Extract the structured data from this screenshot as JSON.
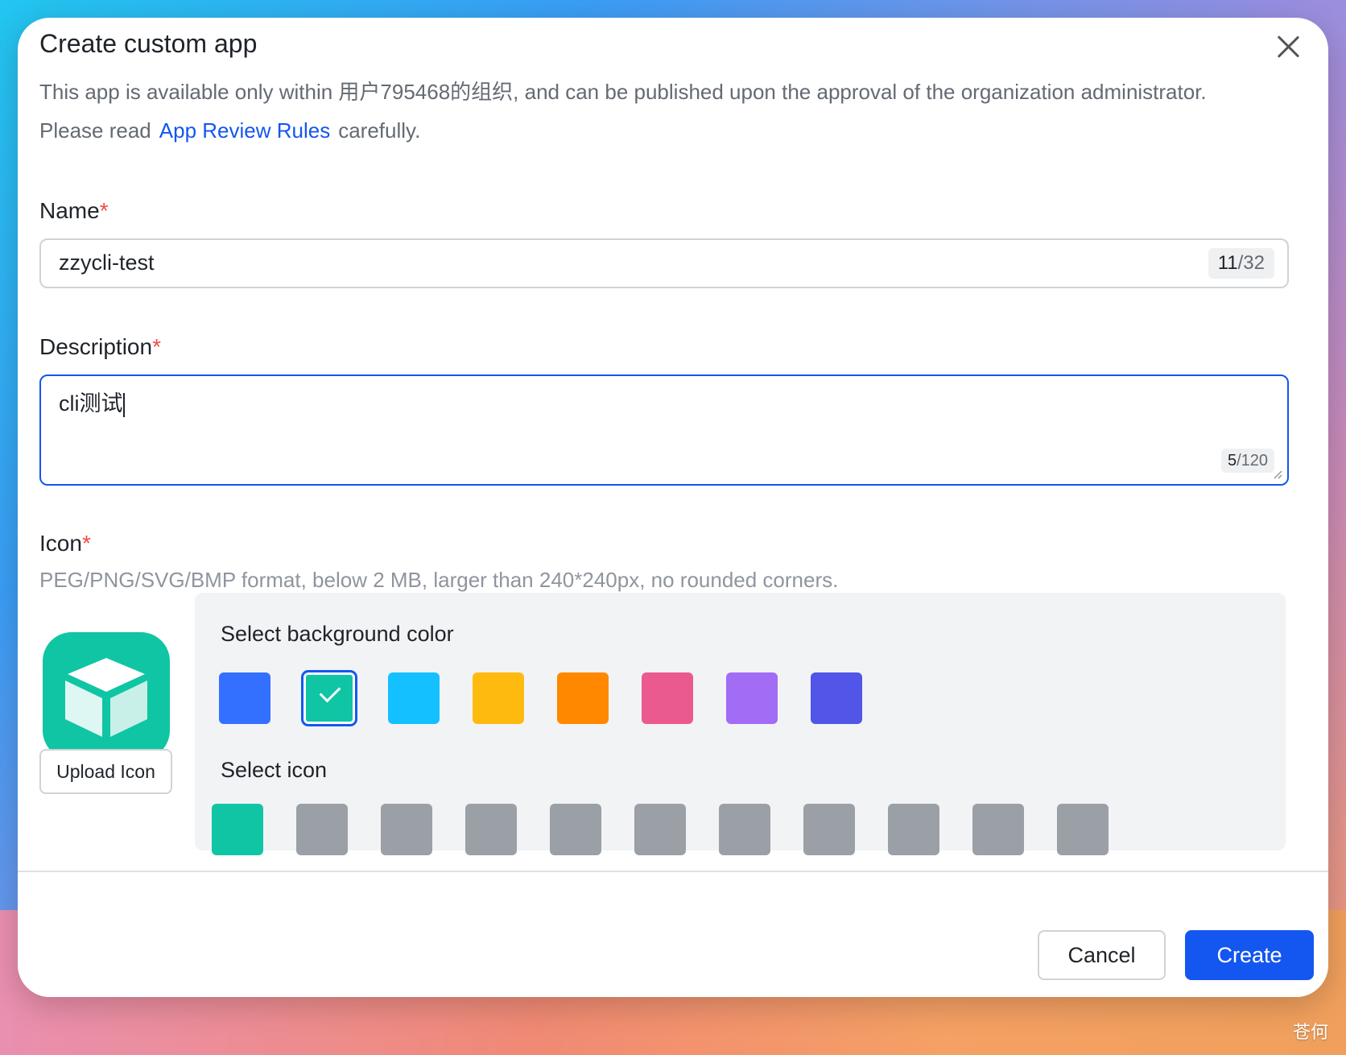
{
  "dialog": {
    "title": "Create custom app",
    "intro_part1": "This app is available only within 用户795468的组织, and can be published upon the approval of the organization administrator. Please read",
    "intro_link": "App Review Rules",
    "intro_part2": "carefully."
  },
  "name_field": {
    "label": "Name",
    "required_mark": "*",
    "value": "zzycli-test",
    "count_current": "11",
    "count_max": "/32"
  },
  "description_field": {
    "label": "Description",
    "required_mark": "*",
    "value": "cli测试",
    "count_current": "5",
    "count_max": "/120"
  },
  "icon_field": {
    "label": "Icon",
    "required_mark": "*",
    "hint": "PEG/PNG/SVG/BMP format, below 2 MB, larger than 240*240px, no rounded corners.",
    "upload_label": "Upload Icon",
    "bg_heading": "Select background color",
    "icon_heading": "Select icon",
    "colors": [
      {
        "name": "blue",
        "hex": "#3370ff",
        "selected": false
      },
      {
        "name": "teal",
        "hex": "#0fc5a4",
        "selected": true
      },
      {
        "name": "cyan",
        "hex": "#14c0ff",
        "selected": false
      },
      {
        "name": "yellow",
        "hex": "#ffba0f",
        "selected": false
      },
      {
        "name": "orange",
        "hex": "#ff8800",
        "selected": false
      },
      {
        "name": "pink",
        "hex": "#ea5a8f",
        "selected": false
      },
      {
        "name": "purple",
        "hex": "#a26cf5",
        "selected": false
      },
      {
        "name": "indigo",
        "hex": "#5155e8",
        "selected": false
      }
    ],
    "icons": [
      {
        "name": "cube-icon",
        "selected": true
      },
      {
        "name": "robot-icon",
        "selected": false
      },
      {
        "name": "lightning-icon",
        "selected": false
      },
      {
        "name": "door-icon",
        "selected": false
      },
      {
        "name": "briefcase-icon",
        "selected": false
      },
      {
        "name": "bell-icon",
        "selected": false
      },
      {
        "name": "checklist-icon",
        "selected": false
      },
      {
        "name": "pie-chart-icon",
        "selected": false
      },
      {
        "name": "star-badge-icon",
        "selected": false
      },
      {
        "name": "tag-icon",
        "selected": false
      },
      {
        "name": "wrench-icon",
        "selected": false
      }
    ]
  },
  "footer": {
    "cancel_label": "Cancel",
    "create_label": "Create"
  },
  "watermark": "苍何"
}
